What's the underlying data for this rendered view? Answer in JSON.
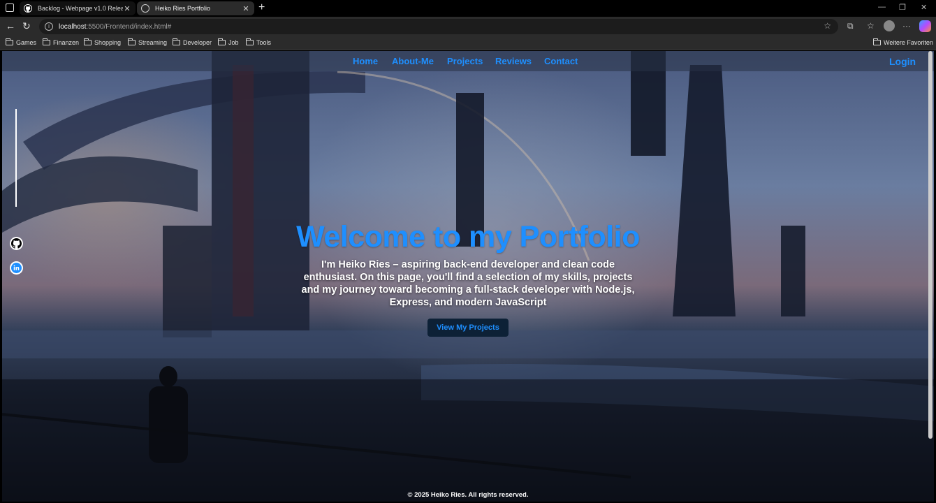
{
  "browser": {
    "tabs": [
      {
        "title": "Backlog - Webpage v1.0 Release |",
        "active": false
      },
      {
        "title": "Heiko Ries Portfolio",
        "active": true
      }
    ],
    "url_host": "localhost",
    "url_path": ":5500/Frontend/index.html#",
    "bookmarks": [
      "Games",
      "Finanzen",
      "Shopping",
      "Streaming",
      "Developer",
      "Job",
      "Tools"
    ],
    "other_favorites": "Weitere Favoriten"
  },
  "page": {
    "nav": [
      "Home",
      "About-Me",
      "Projects",
      "Reviews",
      "Contact"
    ],
    "login": "Login",
    "hero_title": "Welcome to my Portfolio",
    "hero_text": "I'm Heiko Ries – aspiring back-end developer and clean code enthusiast. On this page, you'll find a selection of my skills, projects and my journey toward becoming a full-stack developer with Node.js, Express, and modern JavaScript",
    "cta": "View My Projects",
    "footer": "© 2025 Heiko Ries. All rights reserved.",
    "accent_color": "#1e8fff"
  }
}
